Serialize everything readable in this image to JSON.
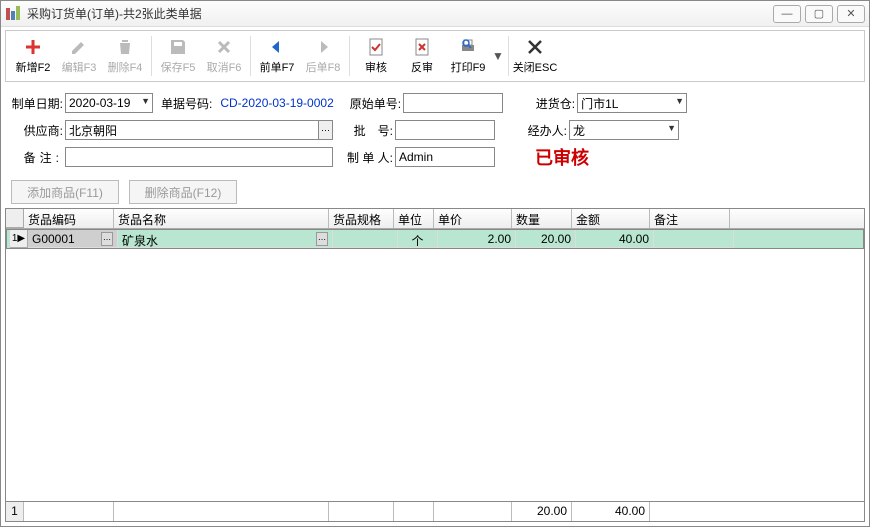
{
  "window": {
    "title": "采购订货单(订单)-共2张此类单据"
  },
  "toolbar": {
    "add": "新增F2",
    "edit": "编辑F3",
    "delete": "删除F4",
    "save": "保存F5",
    "cancel": "取消F6",
    "prev": "前单F7",
    "next": "后单F8",
    "audit": "审核",
    "unaudit": "反审",
    "print": "打印F9",
    "close": "关闭ESC"
  },
  "form": {
    "date_label": "制单日期:",
    "date_value": "2020-03-19",
    "billno_label": "单据号码:",
    "billno_value": "CD-2020-03-19-0002",
    "orig_label": "原始单号:",
    "orig_value": "",
    "warehouse_label": "进货仓:",
    "warehouse_value": "门市1L",
    "supplier_label": "供应商:",
    "supplier_value": "北京朝阳",
    "batch_label": "批　号:",
    "batch_value": "",
    "handler_label": "经办人:",
    "handler_value": "龙",
    "remark_label": "备注:",
    "remark_value": "",
    "maker_label": "制 单 人:",
    "maker_value": "Admin",
    "stamp": "已审核"
  },
  "buttons": {
    "add_item": "添加商品(F11)",
    "del_item": "删除商品(F12)"
  },
  "grid": {
    "cols": [
      "货品编码",
      "货品名称",
      "货品规格",
      "单位",
      "单价",
      "数量",
      "金额",
      "备注"
    ],
    "rows": [
      {
        "idx": "1",
        "code": "G00001",
        "name": "矿泉水",
        "spec": "",
        "unit": "个",
        "price": "2.00",
        "qty": "20.00",
        "amount": "40.00",
        "remark": ""
      }
    ],
    "totals": {
      "idx": "1",
      "qty": "20.00",
      "amount": "40.00"
    }
  }
}
